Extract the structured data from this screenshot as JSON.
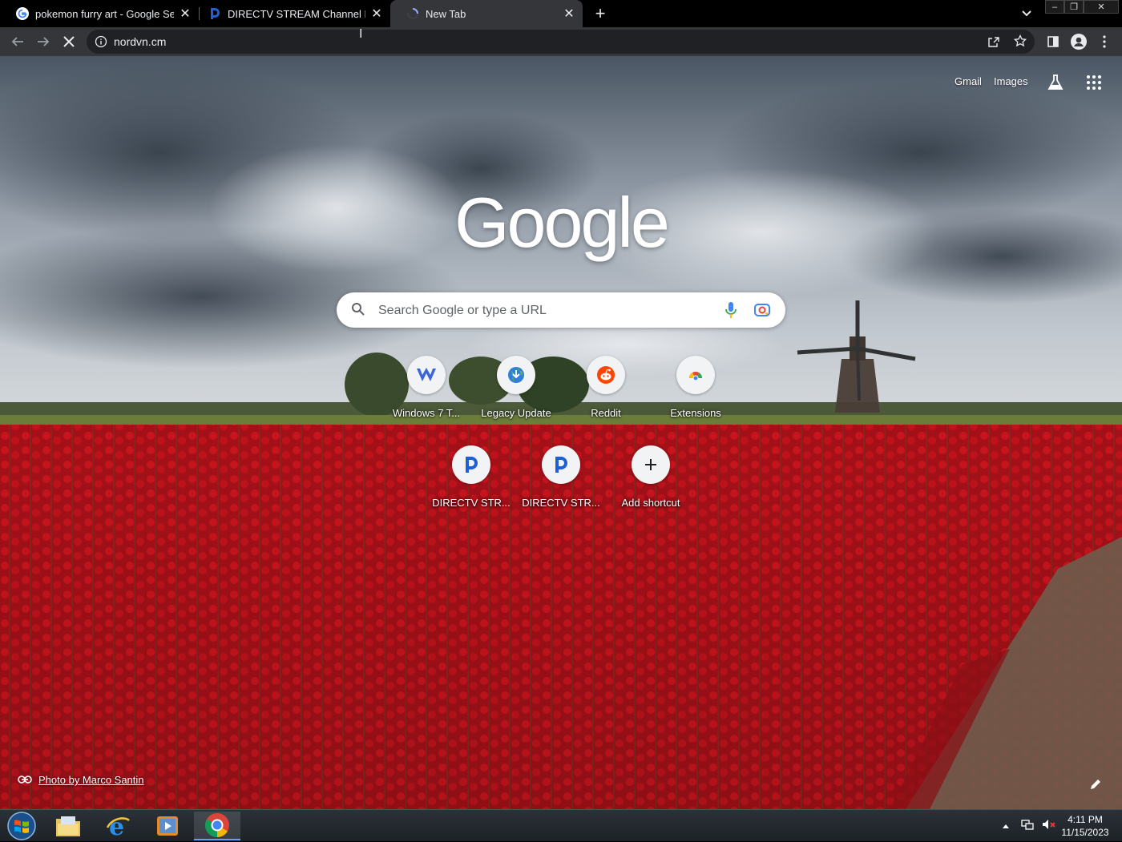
{
  "browser": {
    "tabs": [
      {
        "title": "pokemon furry art - Google Sear",
        "favicon": "google-g-icon",
        "active": false
      },
      {
        "title": "DIRECTV STREAM Channel Lineup",
        "favicon": "directv-icon",
        "active": false
      },
      {
        "title": "New Tab",
        "favicon": "loading-spinner-icon",
        "active": true
      }
    ],
    "address": {
      "url": "nordvn.cm"
    }
  },
  "newtab": {
    "top_links": {
      "gmail": "Gmail",
      "images": "Images"
    },
    "logo_text": "Google",
    "search": {
      "placeholder": "Search Google or type a URL"
    },
    "shortcuts": [
      {
        "label": "Windows 7 T...",
        "icon": "windows7-tools-icon"
      },
      {
        "label": "Legacy Update",
        "icon": "legacy-update-globe-icon"
      },
      {
        "label": "Reddit",
        "icon": "reddit-icon"
      },
      {
        "label": "Extensions",
        "icon": "chrome-extensions-icon"
      },
      {
        "label": "DIRECTV STR...",
        "icon": "directv-icon"
      },
      {
        "label": "DIRECTV STR...",
        "icon": "directv-icon"
      },
      {
        "label": "Add shortcut",
        "icon": "plus-icon"
      }
    ],
    "photo_credit": "Photo by Marco Santin"
  },
  "taskbar": {
    "clock": {
      "time": "4:11 PM",
      "date": "11/15/2023"
    }
  },
  "colors": {
    "tab_active": "#35363a",
    "toolbar": "#35363a",
    "omnibox": "#202124",
    "tulip_red": "#c8101a"
  }
}
